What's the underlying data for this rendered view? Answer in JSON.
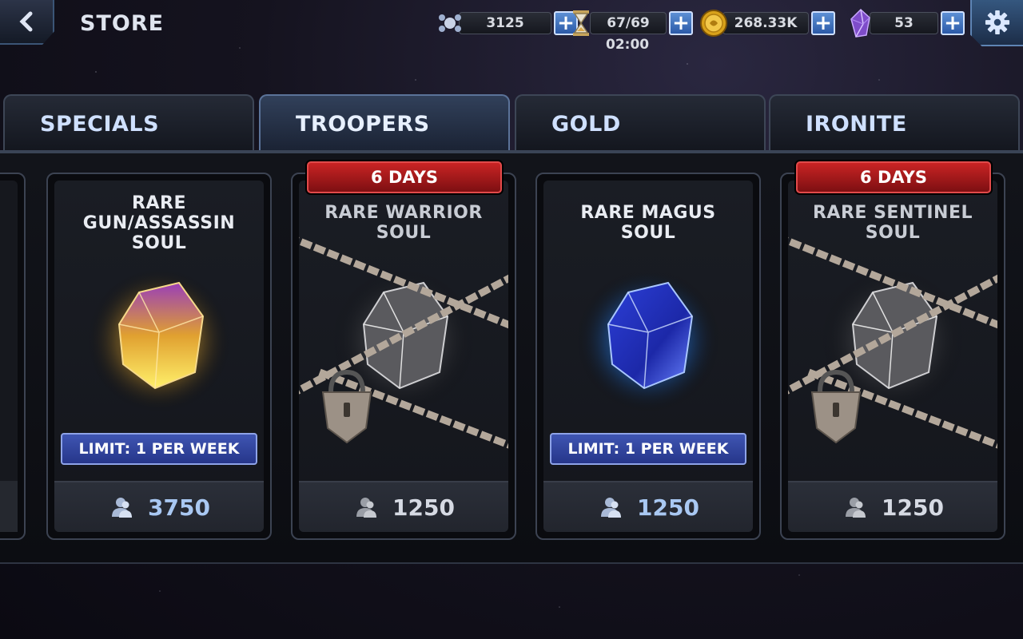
{
  "header": {
    "title": "STORE",
    "resources": [
      {
        "icon": "trooper-points-icon",
        "value": "3125"
      },
      {
        "icon": "hourglass-icon",
        "value": "67/69"
      },
      {
        "icon": "gold-coin-icon",
        "value": "268.33K"
      },
      {
        "icon": "ironite-crystal-icon",
        "value": "53"
      }
    ],
    "timer": "02:00"
  },
  "tabs": [
    {
      "label": "SPECIALS",
      "active": false
    },
    {
      "label": "TROOPERS",
      "active": true
    },
    {
      "label": "GOLD",
      "active": false
    },
    {
      "label": "IRONITE",
      "active": false
    }
  ],
  "cards": [
    {
      "name": "RARE GUN/ASSASSIN SOUL",
      "gem_color": "purple-gold",
      "locked": false,
      "limit": "LIMIT: 1 PER WEEK",
      "badge": "",
      "price": "3750"
    },
    {
      "name": "RARE WARRIOR SOUL",
      "gem_color": "grey",
      "locked": true,
      "limit": "",
      "badge": "6 DAYS",
      "price": "1250"
    },
    {
      "name": "RARE MAGUS SOUL",
      "gem_color": "blue",
      "locked": false,
      "limit": "LIMIT: 1 PER WEEK",
      "badge": "",
      "price": "1250"
    },
    {
      "name": "RARE SENTINEL SOUL",
      "gem_color": "grey",
      "locked": true,
      "limit": "",
      "badge": "6 DAYS",
      "price": "1250"
    }
  ],
  "colors": {
    "accent_blue": "#2b5aa8",
    "badge_red": "#c92424",
    "limit_blue": "#3f55b2"
  }
}
